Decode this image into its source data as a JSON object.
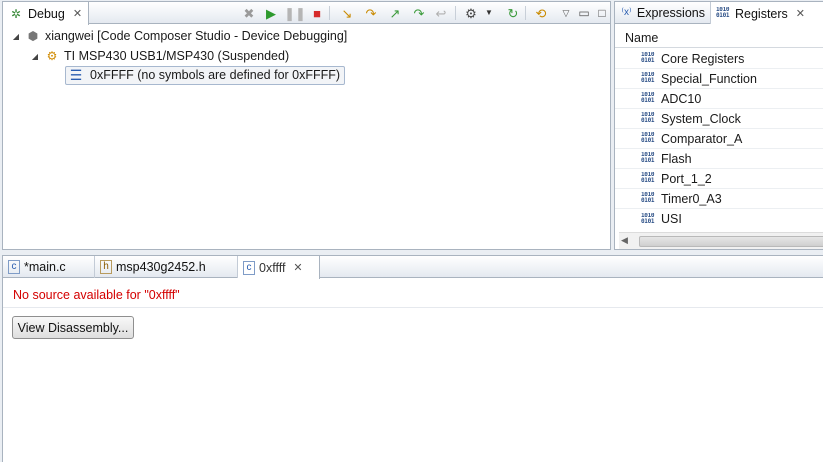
{
  "debug_view": {
    "tab_label": "Debug",
    "tree": [
      {
        "label": "xiangwei [Code Composer Studio - Device Debugging]"
      },
      {
        "label": "TI MSP430 USB1/MSP430 (Suspended)"
      },
      {
        "label": "0xFFFF  (no symbols are defined for 0xFFFF)"
      }
    ],
    "toolbar_icons": [
      "remove-all-terminated-icon",
      "resume-icon",
      "suspend-icon",
      "terminate-icon",
      "step-into-icon",
      "step-over-icon",
      "step-return-icon",
      "assembly-step-icon",
      "drop-to-frame-icon",
      "reset-cpu-icon",
      "restart-icon",
      "refresh-icon",
      "view-menu-icon",
      "minimize-icon",
      "maximize-icon"
    ]
  },
  "side_views": {
    "tabs": [
      {
        "label": "Expressions"
      },
      {
        "label": "Registers"
      }
    ],
    "column_header": "Name",
    "registers": [
      "Core Registers",
      "Special_Function",
      "ADC10",
      "System_Clock",
      "Comparator_A",
      "Flash",
      "Port_1_2",
      "Timer0_A3",
      "USI"
    ]
  },
  "editor": {
    "tabs": [
      {
        "label": "*main.c"
      },
      {
        "label": "msp430g2452.h"
      },
      {
        "label": "0xffff"
      }
    ],
    "message": "No source available for \"0xffff\"",
    "button_label": "View Disassembly..."
  },
  "colors": {
    "error_text": "#d40000",
    "panel_border": "#a9b3bf",
    "background": "#eaeef3"
  }
}
